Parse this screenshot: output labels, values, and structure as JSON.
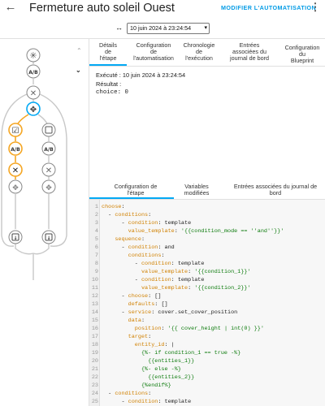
{
  "header": {
    "back_icon": "arrow-left-icon",
    "title": "Fermeture auto soleil Ouest",
    "edit_label": "MODIFIER L'AUTOMATISATION",
    "more_icon": "more-vert-icon",
    "colors": {
      "accent": "#039be5",
      "highlight": "#f5a623"
    }
  },
  "date_selector": {
    "icon": "swap-arrows-icon",
    "selected": "10 juin 2024 à 23:24:54"
  },
  "tabs": [
    {
      "label": "Détails de l'étape",
      "lines": [
        "Détails",
        "de",
        "l'étape"
      ],
      "active": true
    },
    {
      "label": "Configuration de l'automatisation",
      "lines": [
        "Configuration",
        "de",
        "l'automatisation"
      ],
      "active": false
    },
    {
      "label": "Chronologie de l'exécution",
      "lines": [
        "Chronologie",
        "de",
        "l'exécution"
      ],
      "active": false
    },
    {
      "label": "Entrées associées du journal de bord",
      "lines": [
        "Entrées",
        "associées du",
        "journal de bord"
      ],
      "active": false
    },
    {
      "label": "Configuration du Blueprint",
      "lines": [
        "Configuration",
        "du",
        "Blueprint"
      ],
      "active": false
    }
  ],
  "trace": {
    "executed": "Exécuté : 10 juin 2024 à 23:24:54",
    "result_label": "Résultat :",
    "result_value": "choice: 0"
  },
  "lower_tabs": [
    {
      "label": "Configuration de l'étape",
      "lines": [
        "Configuration de",
        "l'étape"
      ],
      "active": true
    },
    {
      "label": "Variables modifiées",
      "lines": [
        "Variables",
        "modifiées"
      ],
      "active": false
    },
    {
      "label": "Entrées associées du journal de bord",
      "lines": [
        "Entrées associées du journal de",
        "bord"
      ],
      "active": false
    }
  ],
  "code_lines": [
    {
      "n": "1",
      "indent": "",
      "key": "choose",
      "rest": ":"
    },
    {
      "n": "2",
      "indent": "  - ",
      "key": "conditions",
      "rest": ":"
    },
    {
      "n": "3",
      "indent": "      - ",
      "key": "condition",
      "rest": ": template"
    },
    {
      "n": "4",
      "indent": "        ",
      "key": "value_template",
      "rest": ": '{{condition_mode == ''and''}}'"
    },
    {
      "n": "5",
      "indent": "    ",
      "key": "sequence",
      "rest": ":"
    },
    {
      "n": "6",
      "indent": "      - ",
      "key": "condition",
      "rest": ": and"
    },
    {
      "n": "7",
      "indent": "        ",
      "key": "conditions",
      "rest": ":"
    },
    {
      "n": "8",
      "indent": "          - ",
      "key": "condition",
      "rest": ": template"
    },
    {
      "n": "9",
      "indent": "            ",
      "key": "value_template",
      "rest": ": '{{condition_1}}'"
    },
    {
      "n": "10",
      "indent": "          - ",
      "key": "condition",
      "rest": ": template"
    },
    {
      "n": "11",
      "indent": "            ",
      "key": "value_template",
      "rest": ": '{{condition_2}}'"
    },
    {
      "n": "12",
      "indent": "      - ",
      "key": "choose",
      "rest": ": []"
    },
    {
      "n": "13",
      "indent": "        ",
      "key": "defaults",
      "rest": ": []"
    },
    {
      "n": "14",
      "indent": "      - ",
      "key": "service",
      "rest": ": cover.set_cover_position"
    },
    {
      "n": "15",
      "indent": "        ",
      "key": "data",
      "rest": ":"
    },
    {
      "n": "16",
      "indent": "          ",
      "key": "position",
      "rest": ": '{{ cover_height | int(0) }}'"
    },
    {
      "n": "17",
      "indent": "        ",
      "key": "target",
      "rest": ":"
    },
    {
      "n": "18",
      "indent": "          ",
      "key": "entity_id",
      "rest": ": |"
    },
    {
      "n": "19",
      "indent": "            ",
      "key": "",
      "rest": "{%- if condition_1 == true -%}"
    },
    {
      "n": "20",
      "indent": "              ",
      "key": "",
      "rest": "{{entities_1}}"
    },
    {
      "n": "21",
      "indent": "            ",
      "key": "",
      "rest": "{%- else -%}"
    },
    {
      "n": "22",
      "indent": "              ",
      "key": "",
      "rest": "{{entities_2}}"
    },
    {
      "n": "23",
      "indent": "            ",
      "key": "",
      "rest": "{%endif%}"
    },
    {
      "n": "24",
      "indent": "  - ",
      "key": "conditions",
      "rest": ":"
    },
    {
      "n": "25",
      "indent": "      - ",
      "key": "condition",
      "rest": ": template"
    }
  ],
  "graph": {
    "nodes": [
      {
        "name": "trigger-node",
        "icon": "asterisk-icon",
        "highlighted": false
      },
      {
        "name": "condition-node",
        "icon": "ab-compare-icon",
        "highlighted": false
      },
      {
        "name": "stop-node",
        "icon": "close-icon",
        "highlighted": false
      },
      {
        "name": "choose-node",
        "icon": "choose-arrows-icon",
        "highlighted": true
      },
      {
        "name": "and-condition-node",
        "icon": "checkbox-marked-icon",
        "highlighted": true
      },
      {
        "name": "option-2-node",
        "icon": "checkbox-blank-icon",
        "highlighted": false
      },
      {
        "name": "ab-node-left",
        "icon": "ab-compare-icon",
        "highlighted": true
      },
      {
        "name": "ab-node-right",
        "icon": "ab-compare-icon",
        "highlighted": false
      },
      {
        "name": "close-node-left",
        "icon": "close-icon",
        "highlighted": true
      },
      {
        "name": "close-node-right",
        "icon": "close-icon",
        "highlighted": false
      },
      {
        "name": "branch-node-left",
        "icon": "choose-arrows-icon",
        "highlighted": false
      },
      {
        "name": "branch-node-right",
        "icon": "choose-arrows-icon",
        "highlighted": false
      },
      {
        "name": "service-node-left",
        "icon": "arrow-collapse-down-icon",
        "highlighted": false
      },
      {
        "name": "service-node-right",
        "icon": "arrow-collapse-down-icon",
        "highlighted": false
      }
    ]
  }
}
